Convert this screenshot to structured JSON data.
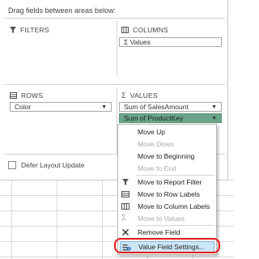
{
  "pane": {
    "drag_label": "Drag fields between areas below:",
    "defer_label": "Defer Layout Update",
    "update_label": "..."
  },
  "areas": {
    "filters": {
      "title": "FILTERS",
      "icon": "filter-icon"
    },
    "columns": {
      "title": "COLUMNS",
      "icon": "columns-icon",
      "fields": [
        "Σ Values"
      ]
    },
    "rows": {
      "title": "ROWS",
      "icon": "rows-icon",
      "fields": [
        "Color"
      ]
    },
    "values": {
      "title": "VALUES",
      "icon": "sigma-icon",
      "fields": [
        "Sum of SalesAmount",
        "Sum of ProductKey"
      ]
    }
  },
  "context_menu": {
    "items": [
      {
        "label": "Move Up",
        "enabled": true
      },
      {
        "label": "Move Down",
        "enabled": false
      },
      {
        "label": "Move to Beginning",
        "enabled": true
      },
      {
        "label": "Move to End",
        "enabled": false
      },
      {
        "label": "Move to Report Filter",
        "enabled": true,
        "icon": "filter-icon"
      },
      {
        "label": "Move to Row Labels",
        "enabled": true,
        "icon": "rows-icon"
      },
      {
        "label": "Move to Column Labels",
        "enabled": true,
        "icon": "columns-icon"
      },
      {
        "label": "Move to Values",
        "enabled": false,
        "icon": "sigma-icon"
      },
      {
        "label": "Remove Field",
        "enabled": true,
        "icon": "remove-x-icon"
      },
      {
        "label": "Value Field Settings...",
        "enabled": true,
        "icon": "field-settings-icon",
        "highlighted": true
      }
    ]
  },
  "colors": {
    "selected_field": "#6aa58a",
    "menu_highlight": "#cde6f7",
    "annotation_red": "#e21a1a"
  }
}
